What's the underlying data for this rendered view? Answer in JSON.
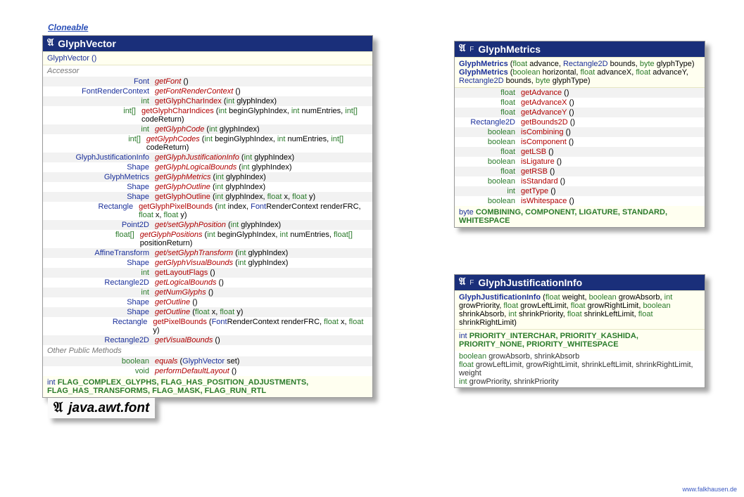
{
  "cloneable_label": "Cloneable",
  "package_label": "java.awt.font",
  "credit": "www.falkhausen.de",
  "glyphvector": {
    "title": "GlyphVector",
    "constructor": "GlyphVector ()",
    "flags": "int  FLAG_COMPLEX_GLYPHS, FLAG_HAS_POSITION_ADJUSTMENTS, FLAG_HAS_TRANSFORMS, FLAG_MASK, FLAG_RUN_RTL",
    "accessor_label": "Accessor",
    "other_label": "Other Public Methods",
    "rows": [
      {
        "ret": "Font",
        "name": "getFont",
        "sig": " ()",
        "style": "ital"
      },
      {
        "ret": "FontRenderContext",
        "name": "getFontRenderContext",
        "sig": " ()",
        "style": "ital"
      },
      {
        "ret": "int",
        "name": "getGlyphCharIndex",
        "sig": " (int glyphIndex)",
        "style": ""
      },
      {
        "ret": "int[]",
        "name": "getGlyphCharIndices",
        "sig": " (int beginGlyphIndex, int numEntries, int[] codeReturn)",
        "style": ""
      },
      {
        "ret": "int",
        "name": "getGlyphCode",
        "sig": " (int glyphIndex)",
        "style": "ital"
      },
      {
        "ret": "int[]",
        "name": "getGlyphCodes",
        "sig": " (int beginGlyphIndex, int numEntries, int[] codeReturn)",
        "style": "ital"
      },
      {
        "ret": "GlyphJustificationInfo",
        "name": "getGlyphJustificationInfo",
        "sig": " (int glyphIndex)",
        "style": "ital"
      },
      {
        "ret": "Shape",
        "name": "getGlyphLogicalBounds",
        "sig": " (int glyphIndex)",
        "style": "ital"
      },
      {
        "ret": "GlyphMetrics",
        "name": "getGlyphMetrics",
        "sig": " (int glyphIndex)",
        "style": "ital"
      },
      {
        "ret": "Shape",
        "name": "getGlyphOutline",
        "sig": " (int glyphIndex)",
        "style": "ital"
      },
      {
        "ret": "Shape",
        "name": "getGlyphOutline",
        "sig": " (int glyphIndex, float x, float y)",
        "style": ""
      },
      {
        "ret": "Rectangle",
        "name": "getGlyphPixelBounds",
        "sig": " (int index, FontRenderContext renderFRC, float x, float y)",
        "style": ""
      },
      {
        "ret": "Point2D",
        "name": "get/setGlyphPosition",
        "sig": " (int glyphIndex)",
        "style": "ital"
      },
      {
        "ret": "float[]",
        "name": "getGlyphPositions",
        "sig": " (int beginGlyphIndex, int numEntries, float[] positionReturn)",
        "style": "ital"
      },
      {
        "ret": "AffineTransform",
        "name": "get/setGlyphTransform",
        "sig": " (int glyphIndex)",
        "style": "ital"
      },
      {
        "ret": "Shape",
        "name": "getGlyphVisualBounds",
        "sig": " (int glyphIndex)",
        "style": "ital"
      },
      {
        "ret": "int",
        "name": "getLayoutFlags",
        "sig": " ()",
        "style": ""
      },
      {
        "ret": "Rectangle2D",
        "name": "getLogicalBounds",
        "sig": " ()",
        "style": "ital"
      },
      {
        "ret": "int",
        "name": "getNumGlyphs",
        "sig": " ()",
        "style": "ital"
      },
      {
        "ret": "Shape",
        "name": "getOutline",
        "sig": " ()",
        "style": "ital"
      },
      {
        "ret": "Shape",
        "name": "getOutline",
        "sig": " (float x, float y)",
        "style": "ital"
      },
      {
        "ret": "Rectangle",
        "name": "getPixelBounds",
        "sig": " (FontRenderContext renderFRC, float x, float y)",
        "style": ""
      },
      {
        "ret": "Rectangle2D",
        "name": "getVisualBounds",
        "sig": " ()",
        "style": "ital"
      }
    ],
    "other": [
      {
        "ret": "boolean",
        "name": "equals",
        "sig": " (GlyphVector set)",
        "style": "ital"
      },
      {
        "ret": "void",
        "name": "performDefaultLayout",
        "sig": " ()",
        "style": "ital"
      }
    ]
  },
  "glyphmetrics": {
    "title": "GlyphMetrics",
    "badge": "F",
    "ctor1": "GlyphMetrics (float advance, Rectangle2D bounds, byte glyphType)",
    "ctor2": "GlyphMetrics (boolean horizontal, float advanceX, float advanceY, Rectangle2D bounds, byte glyphType)",
    "flags": "byte  COMBINING, COMPONENT, LIGATURE, STANDARD, WHITESPACE",
    "rows": [
      {
        "ret": "float",
        "name": "getAdvance",
        "sig": " ()"
      },
      {
        "ret": "float",
        "name": "getAdvanceX",
        "sig": " ()"
      },
      {
        "ret": "float",
        "name": "getAdvanceY",
        "sig": " ()"
      },
      {
        "ret": "Rectangle2D",
        "name": "getBounds2D",
        "sig": " ()"
      },
      {
        "ret": "boolean",
        "name": "isCombining",
        "sig": " ()"
      },
      {
        "ret": "boolean",
        "name": "isComponent",
        "sig": " ()"
      },
      {
        "ret": "float",
        "name": "getLSB",
        "sig": " ()"
      },
      {
        "ret": "boolean",
        "name": "isLigature",
        "sig": " ()"
      },
      {
        "ret": "float",
        "name": "getRSB",
        "sig": " ()"
      },
      {
        "ret": "boolean",
        "name": "isStandard",
        "sig": " ()"
      },
      {
        "ret": "int",
        "name": "getType",
        "sig": " ()"
      },
      {
        "ret": "boolean",
        "name": "isWhitespace",
        "sig": " ()"
      }
    ]
  },
  "glyphjust": {
    "title": "GlyphJustificationInfo",
    "badge": "F",
    "ctor": "GlyphJustificationInfo (float weight, boolean growAbsorb, int growPriority, float growLeftLimit, float growRightLimit, boolean shrinkAbsorb, int shrinkPriority, float shrinkLeftLimit, float shrinkRightLimit)",
    "flags": "int  PRIORITY_INTERCHAR, PRIORITY_KASHIDA, PRIORITY_NONE, PRIORITY_WHITESPACE",
    "fields": [
      "boolean growAbsorb, shrinkAbsorb",
      "float growLeftLimit, growRightLimit, shrinkLeftLimit, shrinkRightLimit, weight",
      "int growPriority, shrinkPriority"
    ]
  }
}
